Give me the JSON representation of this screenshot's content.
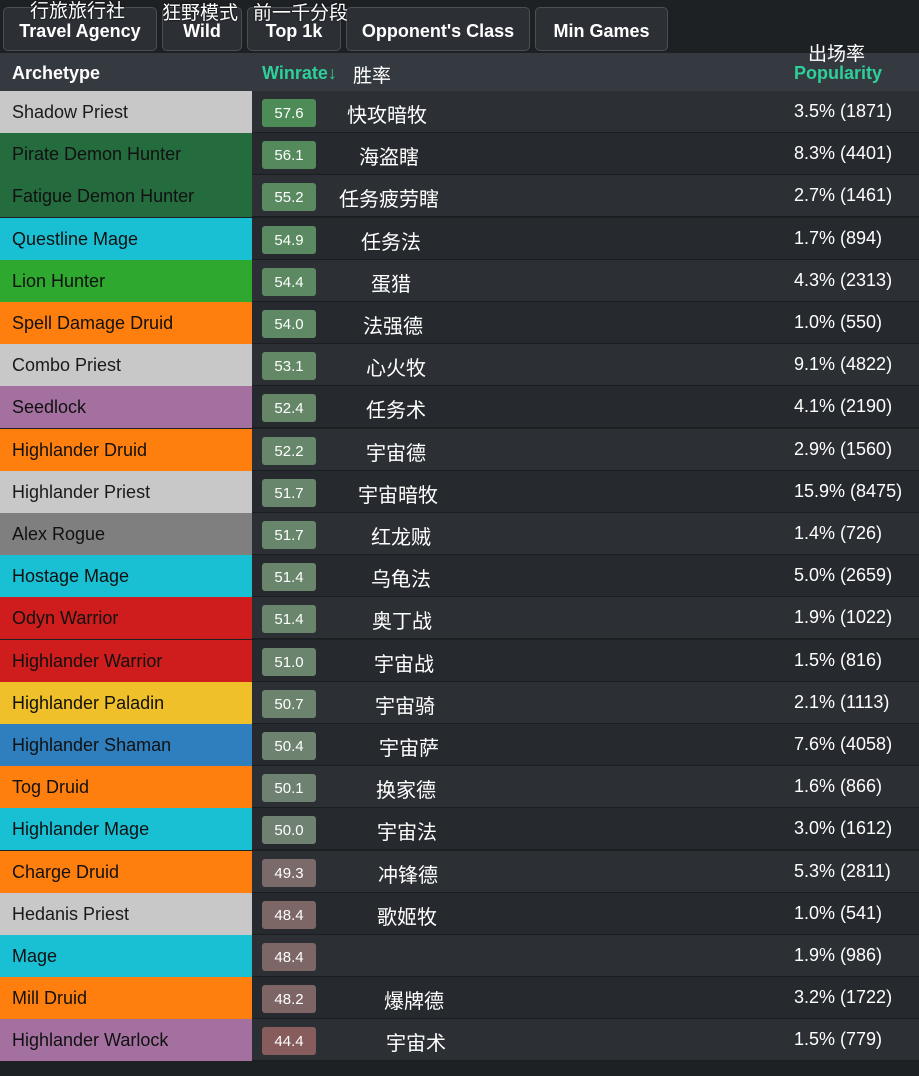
{
  "filters": [
    {
      "label": "Travel Agency",
      "note": "行旅旅行社"
    },
    {
      "label": "Wild",
      "note": "狂野模式"
    },
    {
      "label": "Top 1k",
      "note": "前一千分段"
    },
    {
      "label": "Opponent's Class",
      "note": ""
    },
    {
      "label": "Min Games",
      "note": ""
    }
  ],
  "header": {
    "archetype": "Archetype",
    "winrate": "Winrate↓",
    "winrate_cn": "胜率",
    "popularity": "Popularity",
    "popularity_cn": "出场率"
  },
  "colors": {
    "accent": "#2ecf9a",
    "winrate_high": "#4f8a5a",
    "winrate_mid": "#667a68",
    "winrate_low": "#7a5f5f"
  },
  "rows": [
    {
      "archetype": "Shadow Priest",
      "color": "#c8c8c8",
      "text_color": "#1a1a1a",
      "winrate": "57.6",
      "wr_color": "#4e8c57",
      "cn": "快攻暗牧",
      "popularity": "3.5% (1871)"
    },
    {
      "archetype": "Pirate Demon Hunter",
      "color": "#246b3d",
      "text_color": "#111111",
      "winrate": "56.1",
      "wr_color": "#548a5c",
      "cn": "海盗瞎",
      "popularity": "8.3% (4401)"
    },
    {
      "archetype": "Fatigue Demon Hunter",
      "color": "#246b3d",
      "text_color": "#111111",
      "winrate": "55.2",
      "wr_color": "#598a60",
      "cn": "任务疲劳瞎",
      "popularity": "2.7% (1461)"
    },
    {
      "archetype": "Questline Mage",
      "color": "#19bfd3",
      "text_color": "#111111",
      "winrate": "54.9",
      "wr_color": "#5a8a61",
      "cn": "任务法",
      "popularity": "1.7% (894)"
    },
    {
      "archetype": "Lion Hunter",
      "color": "#2ea82f",
      "text_color": "#111111",
      "winrate": "54.4",
      "wr_color": "#5c8962",
      "cn": "蛋猎",
      "popularity": "4.3% (2313)"
    },
    {
      "archetype": "Spell Damage Druid",
      "color": "#ff7f0e",
      "text_color": "#111111",
      "winrate": "54.0",
      "wr_color": "#5e8964",
      "cn": "法强德",
      "popularity": "1.0% (550)"
    },
    {
      "archetype": "Combo Priest",
      "color": "#c8c8c8",
      "text_color": "#1a1a1a",
      "winrate": "53.1",
      "wr_color": "#628866",
      "cn": "心火牧",
      "popularity": "9.1% (4822)"
    },
    {
      "archetype": "Seedlock",
      "color": "#a370a0",
      "text_color": "#111111",
      "winrate": "52.4",
      "wr_color": "#658768",
      "cn": "任务术",
      "popularity": "4.1% (2190)"
    },
    {
      "archetype": "Highlander Druid",
      "color": "#ff7f0e",
      "text_color": "#111111",
      "winrate": "52.2",
      "wr_color": "#66876a",
      "cn": "宇宙德",
      "popularity": "2.9% (1560)"
    },
    {
      "archetype": "Highlander Priest",
      "color": "#c8c8c8",
      "text_color": "#1a1a1a",
      "winrate": "51.7",
      "wr_color": "#68866b",
      "cn": "宇宙暗牧",
      "popularity": "15.9% (8475)"
    },
    {
      "archetype": "Alex Rogue",
      "color": "#7f7f7f",
      "text_color": "#111111",
      "winrate": "51.7",
      "wr_color": "#68866b",
      "cn": "红龙贼",
      "popularity": "1.4% (726)"
    },
    {
      "archetype": "Hostage Mage",
      "color": "#19bfd3",
      "text_color": "#111111",
      "winrate": "51.4",
      "wr_color": "#69856c",
      "cn": "乌龟法",
      "popularity": "5.0% (2659)"
    },
    {
      "archetype": "Odyn Warrior",
      "color": "#cf1d1d",
      "text_color": "#111111",
      "winrate": "51.4",
      "wr_color": "#69856c",
      "cn": "奥丁战",
      "popularity": "1.9% (1022)"
    },
    {
      "archetype": "Highlander Warrior",
      "color": "#cf1d1d",
      "text_color": "#111111",
      "winrate": "51.0",
      "wr_color": "#6b846d",
      "cn": "宇宙战",
      "popularity": "1.5% (816)"
    },
    {
      "archetype": "Highlander Paladin",
      "color": "#f0c02a",
      "text_color": "#111111",
      "winrate": "50.7",
      "wr_color": "#6c836e",
      "cn": "宇宙骑",
      "popularity": "2.1% (1113)"
    },
    {
      "archetype": "Highlander Shaman",
      "color": "#2f7fbf",
      "text_color": "#111111",
      "winrate": "50.4",
      "wr_color": "#6d826f",
      "cn": "宇宙萨",
      "popularity": "7.6% (4058)"
    },
    {
      "archetype": "Tog Druid",
      "color": "#ff7f0e",
      "text_color": "#111111",
      "winrate": "50.1",
      "wr_color": "#6f8170",
      "cn": "换家德",
      "popularity": "1.6% (866)"
    },
    {
      "archetype": "Highlander Mage",
      "color": "#19bfd3",
      "text_color": "#111111",
      "winrate": "50.0",
      "wr_color": "#6f8170",
      "cn": "宇宙法",
      "popularity": "3.0% (1612)"
    },
    {
      "archetype": "Charge Druid",
      "color": "#ff7f0e",
      "text_color": "#111111",
      "winrate": "49.3",
      "wr_color": "#7a6a6a",
      "cn": "冲锋德",
      "popularity": "5.3% (2811)"
    },
    {
      "archetype": "Hedanis Priest",
      "color": "#c8c8c8",
      "text_color": "#1a1a1a",
      "winrate": "48.4",
      "wr_color": "#7d6666",
      "cn": "歌姬牧",
      "popularity": "1.0% (541)"
    },
    {
      "archetype": "Mage",
      "color": "#19bfd3",
      "text_color": "#111111",
      "winrate": "48.4",
      "wr_color": "#7d6666",
      "cn": "",
      "popularity": "1.9% (986)"
    },
    {
      "archetype": "Mill Druid",
      "color": "#ff7f0e",
      "text_color": "#111111",
      "winrate": "48.2",
      "wr_color": "#7e6565",
      "cn": "爆牌德",
      "popularity": "3.2% (1722)"
    },
    {
      "archetype": "Highlander Warlock",
      "color": "#a370a0",
      "text_color": "#111111",
      "winrate": "44.4",
      "wr_color": "#875c5c",
      "cn": "宇宙术",
      "popularity": "1.5% (779)"
    }
  ]
}
